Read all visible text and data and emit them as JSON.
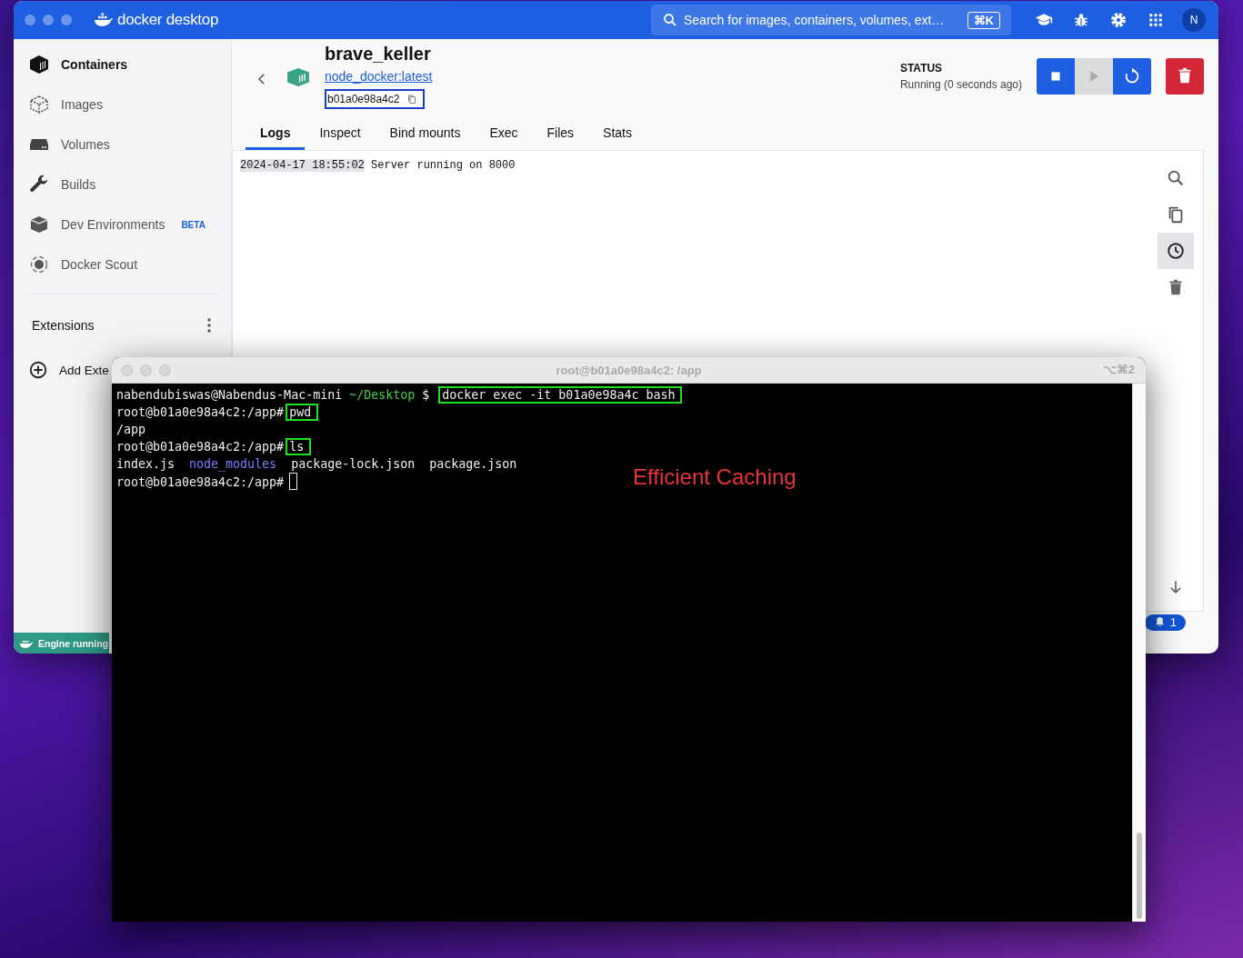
{
  "docker_window": {
    "brand": "docker desktop",
    "search": {
      "placeholder": "Search for images, containers, volumes, ext…",
      "shortcut": "⌘K"
    },
    "avatar": "N",
    "sidebar": {
      "items": [
        {
          "label": "Containers",
          "selected": true
        },
        {
          "label": "Images",
          "selected": false
        },
        {
          "label": "Volumes",
          "selected": false
        },
        {
          "label": "Builds",
          "selected": false
        },
        {
          "label": "Dev Environments",
          "badge": "BETA",
          "selected": false
        },
        {
          "label": "Docker Scout",
          "selected": false
        }
      ],
      "extensions_label": "Extensions",
      "add_extensions": "Add Exte"
    },
    "container": {
      "name": "brave_keller",
      "image": "node_docker:latest",
      "id": "b01a0e98a4c2",
      "status_label": "STATUS",
      "status": "Running (0 seconds ago)"
    },
    "actions": [
      {
        "kind": "stop",
        "disabled": false
      },
      {
        "kind": "start",
        "disabled": true
      },
      {
        "kind": "restart",
        "disabled": false
      },
      {
        "kind": "delete",
        "disabled": false
      }
    ],
    "tabs": [
      {
        "label": "Logs",
        "selected": true
      },
      {
        "label": "Inspect",
        "selected": false
      },
      {
        "label": "Bind mounts",
        "selected": false
      },
      {
        "label": "Exec",
        "selected": false
      },
      {
        "label": "Files",
        "selected": false
      },
      {
        "label": "Stats",
        "selected": false
      }
    ],
    "log_lines": [
      {
        "timestamp": "2024-04-17 18:55:02",
        "message": "Server running on 8000"
      }
    ],
    "log_tools": [
      {
        "kind": "search",
        "selected": false
      },
      {
        "kind": "copy",
        "selected": false
      },
      {
        "kind": "timestamps",
        "selected": true
      },
      {
        "kind": "clear",
        "selected": false
      }
    ],
    "engine_status": "Engine running",
    "notifications": "1"
  },
  "terminal_window": {
    "title": "root@b01a0e98a4c2: /app",
    "shortcut": "⌥⌘2",
    "lines": [
      [
        {
          "text": "nabendubiswas@Nabendus-Mac-mini ",
          "kind": "plain"
        },
        {
          "text": "~/Desktop",
          "kind": "path"
        },
        {
          "text": " $ ",
          "kind": "plain"
        },
        {
          "text": "docker exec -it b01a0e98a4c bash",
          "kind": "highlight"
        }
      ],
      [
        {
          "text": "root@b01a0e98a4c2:/app#",
          "kind": "plain"
        },
        {
          "text": "pwd",
          "kind": "highlight"
        }
      ],
      [
        {
          "text": "/app",
          "kind": "plain"
        }
      ],
      [
        {
          "text": "root@b01a0e98a4c2:/app#",
          "kind": "plain"
        },
        {
          "text": "ls",
          "kind": "highlight"
        }
      ],
      [
        {
          "text": "index.js",
          "kind": "plain"
        },
        {
          "text": "node_modules",
          "kind": "dir"
        },
        {
          "text": "package-lock.json",
          "kind": "plain"
        },
        {
          "text": "package.json",
          "kind": "plain"
        }
      ],
      [
        {
          "text": "root@b01a0e98a4c2:/app#",
          "kind": "plain"
        },
        {
          "kind": "cursor"
        }
      ]
    ],
    "annotation": "Efficient Caching"
  }
}
